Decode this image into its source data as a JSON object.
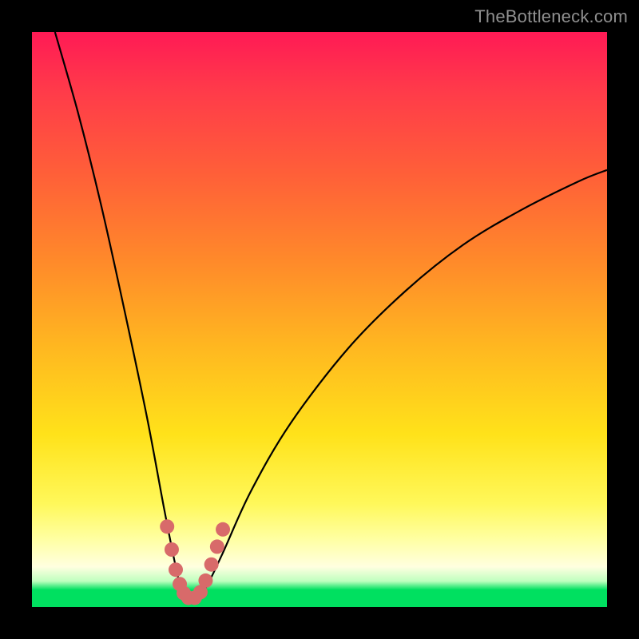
{
  "watermark": "TheBottleneck.com",
  "colors": {
    "background": "#000000",
    "gradient_top": "#ff1a55",
    "gradient_mid": "#ffe21a",
    "gradient_bottom": "#00e060",
    "curve": "#000000",
    "marker": "#d86a6a"
  },
  "chart_data": {
    "type": "line",
    "title": "",
    "xlabel": "",
    "ylabel": "",
    "xlim": [
      0,
      100
    ],
    "ylim": [
      0,
      100
    ],
    "grid": false,
    "legend": false,
    "curve": {
      "name": "bottleneck-curve",
      "minimum_x": 27,
      "points": [
        {
          "x": 4,
          "y": 100
        },
        {
          "x": 8,
          "y": 86
        },
        {
          "x": 12,
          "y": 70
        },
        {
          "x": 16,
          "y": 52
        },
        {
          "x": 20,
          "y": 33
        },
        {
          "x": 23,
          "y": 17
        },
        {
          "x": 25,
          "y": 7
        },
        {
          "x": 26,
          "y": 3
        },
        {
          "x": 27,
          "y": 1.5
        },
        {
          "x": 28,
          "y": 1.5
        },
        {
          "x": 30,
          "y": 3
        },
        {
          "x": 33,
          "y": 9
        },
        {
          "x": 38,
          "y": 20
        },
        {
          "x": 45,
          "y": 32
        },
        {
          "x": 55,
          "y": 45
        },
        {
          "x": 65,
          "y": 55
        },
        {
          "x": 75,
          "y": 63
        },
        {
          "x": 85,
          "y": 69
        },
        {
          "x": 95,
          "y": 74
        },
        {
          "x": 100,
          "y": 76
        }
      ]
    },
    "markers": {
      "name": "sweet-spot",
      "points": [
        {
          "x": 23.5,
          "y": 14
        },
        {
          "x": 24.3,
          "y": 10
        },
        {
          "x": 25,
          "y": 6.5
        },
        {
          "x": 25.7,
          "y": 4
        },
        {
          "x": 26.4,
          "y": 2.4
        },
        {
          "x": 27.2,
          "y": 1.6
        },
        {
          "x": 28.3,
          "y": 1.6
        },
        {
          "x": 29.3,
          "y": 2.6
        },
        {
          "x": 30.2,
          "y": 4.6
        },
        {
          "x": 31.2,
          "y": 7.4
        },
        {
          "x": 32.2,
          "y": 10.5
        },
        {
          "x": 33.2,
          "y": 13.5
        }
      ]
    }
  }
}
